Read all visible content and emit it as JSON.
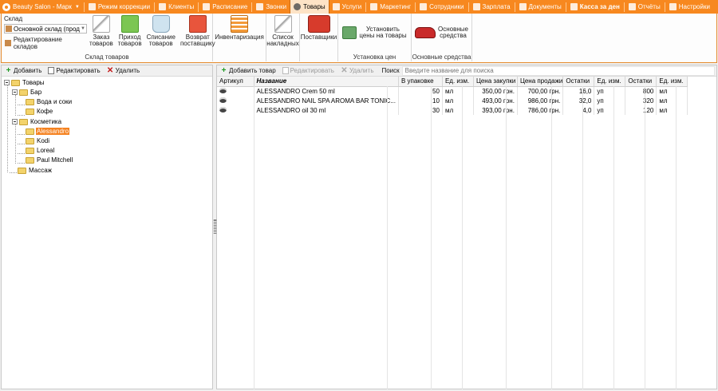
{
  "topbar": {
    "app_title": "Beauty Salon - Марк",
    "items": [
      {
        "label": "Режим коррекции",
        "icon": "correction-icon"
      },
      {
        "label": "Клиенты",
        "icon": "clients-icon"
      },
      {
        "label": "Расписание",
        "icon": "schedule-icon"
      },
      {
        "label": "Звонки",
        "icon": "calls-icon"
      },
      {
        "label": "Товары",
        "icon": "products-icon",
        "active": true
      },
      {
        "label": "Услуги",
        "icon": "services-icon"
      },
      {
        "label": "Маркетинг",
        "icon": "marketing-icon"
      },
      {
        "label": "Сотрудники",
        "icon": "employees-icon"
      },
      {
        "label": "Зарплата",
        "icon": "salary-icon"
      },
      {
        "label": "Документы",
        "icon": "documents-icon"
      },
      {
        "label": "Касса за ден",
        "icon": "cashbox-icon",
        "bold": true
      },
      {
        "label": "Отчёты",
        "icon": "reports-icon"
      },
      {
        "label": "Настройки",
        "icon": "settings-icon"
      }
    ],
    "colors": {
      "accent": "#f7881f",
      "selection": "#f58220"
    }
  },
  "ribbon": {
    "sklad": {
      "title": "Склад",
      "combo_value": "Основной склад (прод",
      "edit_label": "Редактирование складов"
    },
    "sklad_group": {
      "caption": "Склад товаров",
      "buttons": [
        {
          "line1": "Заказ",
          "line2": "товаров",
          "icon": "order-icon"
        },
        {
          "line1": "Приход",
          "line2": "товаров",
          "icon": "incoming-icon"
        },
        {
          "line1": "Списание",
          "line2": "товаров",
          "icon": "writeoff-icon"
        },
        {
          "line1": "Возврат",
          "line2": "поставщику",
          "icon": "return-icon"
        }
      ]
    },
    "inventory_label": "Инвентаризация",
    "invoices": {
      "line1": "Список",
      "line2": "накладных"
    },
    "suppliers_label": "Поставщики",
    "prices": {
      "line1": "Установить",
      "line2": "цены на товары",
      "caption": "Установка цен"
    },
    "assets": {
      "line1": "Основные",
      "line2": "средства",
      "caption": "Основные средства"
    }
  },
  "left": {
    "toolbar": {
      "add": "Добавить",
      "edit": "Редактировать",
      "delete": "Удалить"
    },
    "tree": {
      "root": "Товары",
      "bar": "Бар",
      "water": "Вода и соки",
      "coffee": "Кофе",
      "cosmetics": "Косметика",
      "alessandro": "Alessandro",
      "kodi": "Kodi",
      "loreal": "Loreal",
      "paul": "Paul Mitchell",
      "massage": "Массаж"
    }
  },
  "right": {
    "toolbar": {
      "add": "Добавить товар",
      "edit": "Редактировать",
      "delete": "Удалить",
      "search_label": "Поиск",
      "search_placeholder": "Введите название для поиска"
    },
    "columns": [
      "Артикул",
      "Название",
      "В упаковке",
      "Ед. изм.",
      "Цена закупки",
      "Цена продажи",
      "Остатки",
      "Ед. изм.",
      "Остатки",
      "Ед. изм."
    ],
    "rows": [
      {
        "article": "",
        "name": "ALESSANDRO Crem 50 ml",
        "pack": "50",
        "unit": "мл",
        "buy": "350,00 грн.",
        "sell": "700,00 грн.",
        "stock1": "16,0",
        "unit1": "уп",
        "stock2": "800",
        "unit2": "мл"
      },
      {
        "article": "",
        "name": "ALESSANDRO NAIL SPA AROMA BAR TONIC...",
        "pack": "10",
        "unit": "мл",
        "buy": "493,00 грн.",
        "sell": "986,00 грн.",
        "stock1": "32,0",
        "unit1": "уп",
        "stock2": "320",
        "unit2": "мл"
      },
      {
        "article": "",
        "name": "ALESSANDRO oil 30 ml",
        "pack": "30",
        "unit": "мл",
        "buy": "393,00 грн.",
        "sell": "786,00 грн.",
        "stock1": "4,0",
        "unit1": "уп",
        "stock2": "120",
        "unit2": "мл"
      }
    ]
  }
}
